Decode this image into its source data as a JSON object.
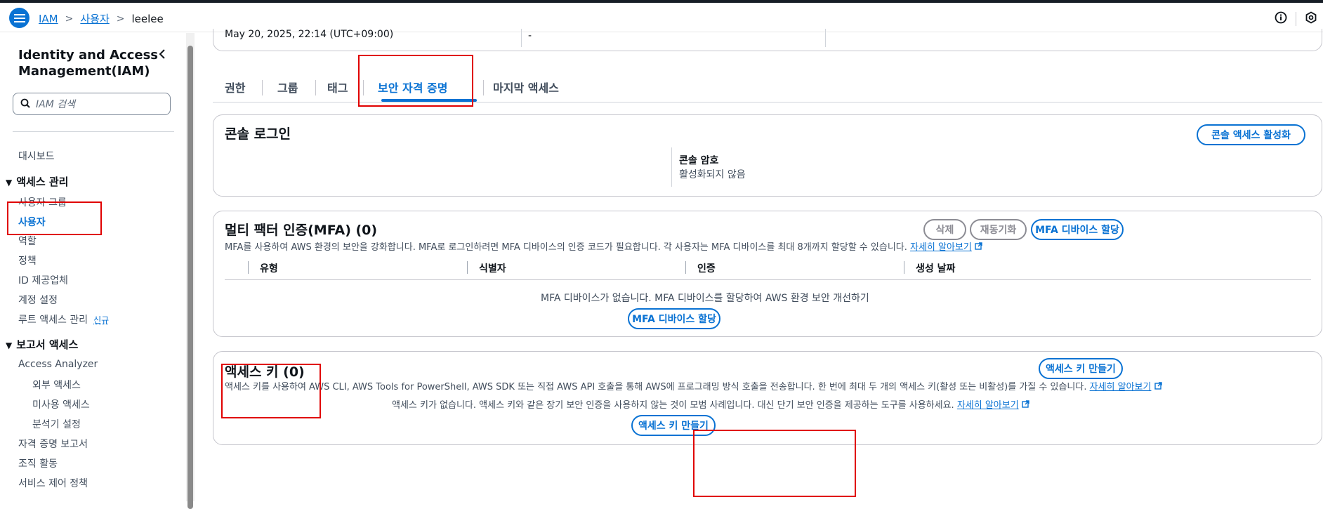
{
  "breadcrumb": {
    "root": "IAM",
    "users": "사용자",
    "current": "leelee"
  },
  "sidebar": {
    "title": "Identity and Access Management(IAM)",
    "search_placeholder": "IAM 검색",
    "dashboard": "대시보드",
    "access_mgmt_header": "액세스 관리",
    "access_items": [
      "사용자 그룹",
      "사용자",
      "역할",
      "정책",
      "ID 제공업체",
      "계정 설정",
      "루트 액세스 관리"
    ],
    "root_new_badge": "신규",
    "reports_header": "보고서 액세스",
    "access_analyzer": "Access Analyzer",
    "analyzer_items": [
      "외부 액세스",
      "미사용 액세스",
      "분석기 설정"
    ],
    "report_items": [
      "자격 증명 보고서",
      "조직 활동",
      "서비스 제어 정책"
    ]
  },
  "summary": {
    "date": "May 20, 2025, 22:14 (UTC+09:00)",
    "value2": "-"
  },
  "tabs": [
    "권한",
    "그룹",
    "태그",
    "보안 자격 증명",
    "마지막 액세스"
  ],
  "console": {
    "title": "콘솔 로그인",
    "enable_button": "콘솔 액세스 활성화",
    "password_label": "콘솔 암호",
    "password_value": "활성화되지 않음"
  },
  "mfa": {
    "title": "멀티 팩터 인증(MFA) (0)",
    "delete_button": "삭제",
    "resync_button": "재동기화",
    "assign_button": "MFA 디바이스 할당",
    "description": "MFA를 사용하여 AWS 환경의 보안을 강화합니다. MFA로 로그인하려면 MFA 디바이스의 인증 코드가 필요합니다. 각 사용자는 MFA 디바이스를 최대 8개까지 할당할 수 있습니다.",
    "learn_more": "자세히 알아보기",
    "columns": [
      "유형",
      "식별자",
      "인증",
      "생성 날짜"
    ],
    "empty_message": "MFA 디바이스가 없습니다. MFA 디바이스를 할당하여 AWS 환경 보안 개선하기",
    "empty_button": "MFA 디바이스 할당"
  },
  "access_keys": {
    "title": "액세스 키 (0)",
    "create_button": "액세스 키 만들기",
    "description": "액세스 키를 사용하여 AWS CLI, AWS Tools for PowerShell, AWS SDK 또는 직접 AWS API 호출을 통해 AWS에 프로그래밍 방식 호출을 전송합니다. 한 번에 최대 두 개의 액세스 키(활성 또는 비활성)를 가질 수 있습니다.",
    "learn_more": "자세히 알아보기",
    "empty_message": "액세스 키가 없습니다. 액세스 키와 같은 장기 보안 인증을 사용하지 않는 것이 모범 사례입니다. 대신 단기 보안 인증을 제공하는 도구를 사용하세요.",
    "empty_learn_more": "자세히 알아보기",
    "empty_button": "액세스 키 만들기"
  },
  "colors": {
    "accent": "#0972d3",
    "highlight": "#e00000"
  }
}
